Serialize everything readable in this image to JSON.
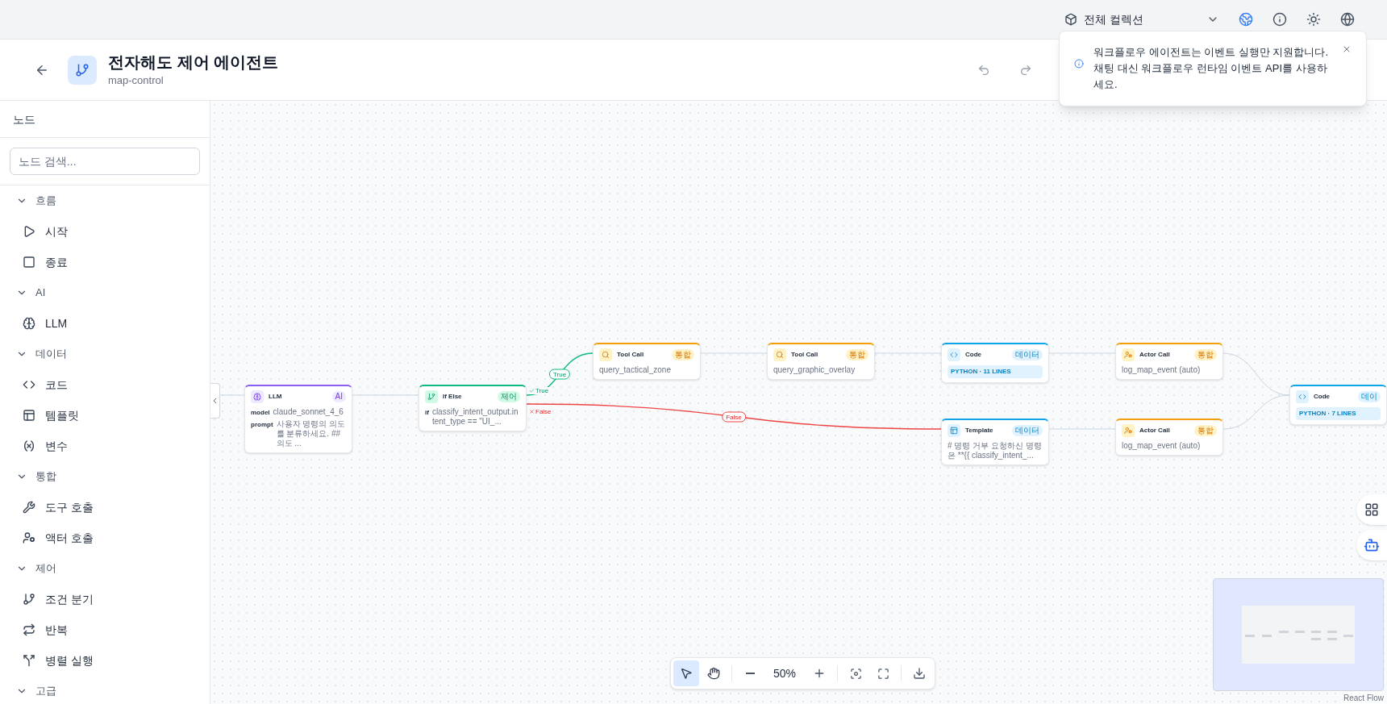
{
  "topbar": {
    "collection": "전체 컬렉션"
  },
  "header": {
    "title": "전자해도 제어 에이전트",
    "subtitle": "map-control"
  },
  "toast": {
    "message": "워크플로우 에이전트는 이벤트 실행만 지원합니다. 채팅 대신 워크플로우 런타임 이벤트 API를 사용하세요."
  },
  "sidebar": {
    "title": "노드",
    "search": {
      "placeholder": "노드 검색..."
    },
    "groups": [
      {
        "label": "흐름",
        "expanded": true,
        "items": [
          {
            "label": "시작",
            "kind": "start"
          },
          {
            "label": "종료",
            "kind": "end"
          }
        ]
      },
      {
        "label": "AI",
        "expanded": true,
        "items": [
          {
            "label": "LLM",
            "kind": "llm"
          }
        ]
      },
      {
        "label": "데이터",
        "expanded": true,
        "items": [
          {
            "label": "코드",
            "kind": "code"
          },
          {
            "label": "템플릿",
            "kind": "template"
          },
          {
            "label": "변수",
            "kind": "variable"
          }
        ]
      },
      {
        "label": "통합",
        "expanded": true,
        "items": [
          {
            "label": "도구 호출",
            "kind": "tool"
          },
          {
            "label": "액터 호출",
            "kind": "actor"
          }
        ]
      },
      {
        "label": "제어",
        "expanded": true,
        "items": [
          {
            "label": "조건 분기",
            "kind": "condition"
          },
          {
            "label": "반복",
            "kind": "loop"
          },
          {
            "label": "병렬 실행",
            "kind": "parallel"
          }
        ]
      },
      {
        "label": "고급",
        "expanded": true
      }
    ]
  },
  "canvas": {
    "nodes": [
      {
        "kind": "llm",
        "title": "LLM",
        "badge": "AI",
        "fields": [
          {
            "key": "model",
            "value": "claude_sonnet_4_6"
          },
          {
            "key": "prompt",
            "value": "사용자 명령의 의도를 분류하세요. ## 의도 ..."
          }
        ]
      },
      {
        "kind": "condition",
        "title": "If Else",
        "badge": "제어",
        "fields": [
          {
            "key": "if",
            "value": "classify_intent_output.intent_type == \"UI_..."
          }
        ],
        "outputs": [
          {
            "kind": "true",
            "label": "True"
          },
          {
            "kind": "false",
            "label": "False"
          }
        ]
      },
      {
        "kind": "tool",
        "title": "Tool Call",
        "badge": "통합",
        "detail": "query_tactical_zone"
      },
      {
        "kind": "tool",
        "title": "Tool Call",
        "badge": "통합",
        "detail": "query_graphic_overlay"
      },
      {
        "kind": "code",
        "title": "Code",
        "badge": "데이터",
        "code": "PYTHON · 11 LINES"
      },
      {
        "kind": "actor",
        "title": "Actor Call",
        "badge": "통합",
        "detail": "log_map_event (auto)"
      },
      {
        "kind": "template",
        "title": "Template",
        "badge": "데이터",
        "detail": "# 명령 거부 요청하신 명령은 **{{ classify_intent_..."
      },
      {
        "kind": "actor",
        "title": "Actor Call",
        "badge": "통합",
        "detail": "log_map_event (auto)"
      },
      {
        "kind": "code",
        "title": "Code",
        "badge": "데이",
        "code": "PYTHON · 7 LINES"
      }
    ],
    "edges": [
      {
        "kind": "default"
      },
      {
        "kind": "true",
        "label": "True"
      },
      {
        "kind": "false",
        "label": "False"
      },
      {
        "kind": "default"
      },
      {
        "kind": "default"
      },
      {
        "kind": "default"
      },
      {
        "kind": "default"
      },
      {
        "kind": "default"
      },
      {
        "kind": "default"
      }
    ],
    "toolbar": {
      "tools": [
        {
          "kind": "select",
          "selected": true
        },
        {
          "kind": "pan",
          "selected": false
        }
      ],
      "zoom": "50%"
    },
    "attribution": "React Flow"
  }
}
